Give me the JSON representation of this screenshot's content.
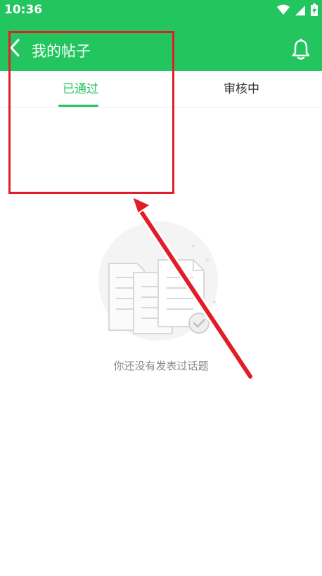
{
  "status_bar": {
    "time": "10:36",
    "icons": [
      "wifi-icon",
      "signal-icon",
      "battery-charging-icon"
    ]
  },
  "app_bar": {
    "title": "我的帖子",
    "back_icon": "chevron-left-icon",
    "notification_icon": "bell-icon"
  },
  "tabs": [
    {
      "label": "已通过",
      "selected": true
    },
    {
      "label": "审核中",
      "selected": false
    }
  ],
  "empty_state": {
    "icon": "documents-check-icon",
    "message": "你还没有发表过话题"
  },
  "colors": {
    "brand_green": "#22c55e",
    "annotation_red": "#e11d27",
    "muted_text": "#8a8a8a"
  }
}
